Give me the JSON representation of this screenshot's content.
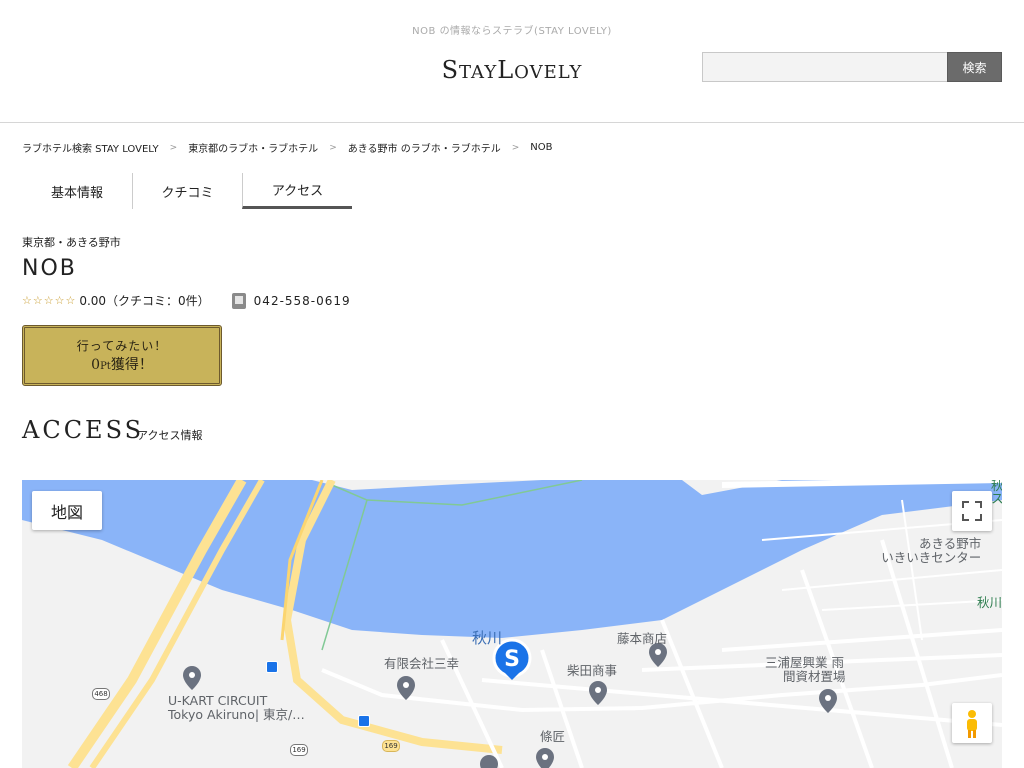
{
  "header": {
    "tagline": "NOB の情報ならステラブ(STAY LOVELY)",
    "logo_big1": "S",
    "logo_small1": "TAY",
    "logo_big2": "L",
    "logo_small2": "OVELY",
    "search_value": "",
    "search_button": "検索"
  },
  "breadcrumb": {
    "items": [
      "ラブホテル検索 STAY LOVELY",
      "東京都のラブホ・ラブホテル",
      "あきる野市 のラブホ・ラブホテル",
      "NOB"
    ],
    "separator": ">"
  },
  "tabs": [
    {
      "label": "基本情報",
      "active": false
    },
    {
      "label": "クチコミ",
      "active": false
    },
    {
      "label": "アクセス",
      "active": true
    }
  ],
  "hotel": {
    "area": "東京都・あきる野市",
    "name": "NOB",
    "stars": "☆☆☆☆☆",
    "rating": "0.00",
    "reviews": "（クチコミ：0件）",
    "phone": "042-558-0619"
  },
  "want_button": {
    "line1": "行ってみたい！",
    "points": "0",
    "unit": "Pt",
    "suffix": "獲得！"
  },
  "access": {
    "title": "ACCESS",
    "subtitle": "アクセス情報"
  },
  "map": {
    "type_button": "地図",
    "labels": {
      "river": "秋川",
      "river_right": "秋川",
      "center": "あきる野市\nいきいきセンター",
      "center_l1": "あきる野市",
      "center_l2": "いきいきセンター",
      "fujimoto": "藤本商店",
      "yugen": "有限会社三幸",
      "shibata": "柴田商事",
      "miura_l1": "三浦屋興業 雨",
      "miura_l2": "間資材置場",
      "ukart_l1": "U-KART CIRCUIT",
      "ukart_l2": "Tokyo Akiruno| 東京/…",
      "joshou": "條匠",
      "top_right_l1": "秋",
      "top_right_l2": "ス"
    },
    "routes": [
      "468",
      "169",
      "169"
    ],
    "colors": {
      "river": "#8ab4f8",
      "road": "#fde293",
      "background": "#f2f2f2",
      "pin": "#5f6368",
      "hotel_marker": "#1a73e8"
    }
  }
}
